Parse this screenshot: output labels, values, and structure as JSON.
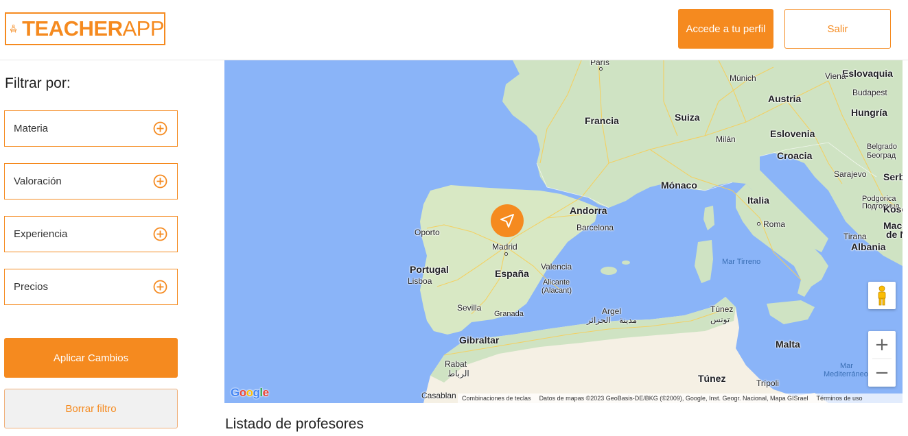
{
  "header": {
    "logo_bold": "TEACHER",
    "logo_light": "APP",
    "profile_button": "Accede a tu perfil",
    "logout_button": "Salir"
  },
  "sidebar": {
    "title": "Filtrar por:",
    "filters": [
      {
        "label": "Materia"
      },
      {
        "label": "Valoración"
      },
      {
        "label": "Experiencia"
      },
      {
        "label": "Precios"
      }
    ],
    "apply_button": "Aplicar Cambios",
    "clear_button": "Borrar filtro"
  },
  "map": {
    "countries": [
      "Francia",
      "Suiza",
      "Austria",
      "Eslovaquia",
      "Hungría",
      "Eslovenia",
      "Croacia",
      "Mónaco",
      "Italia",
      "Andorra",
      "Portugal",
      "España",
      "Gibraltar",
      "Malta",
      "Serbia",
      "Albania"
    ],
    "cities": [
      "París",
      "Múnich",
      "Viena",
      "Budapest",
      "Milán",
      "Belgrado",
      "Београд",
      "Sarajevo",
      "Podgorica",
      "Подгорица",
      "Kosov",
      "Mace",
      "de N",
      "Tirana",
      "Roma",
      "Barcelona",
      "Madrid",
      "Oporto",
      "Lisboa",
      "Valencia",
      "Alicante",
      "(Alacant)",
      "Sevilla",
      "Granada",
      "Argel",
      "الجزائر",
      "Túnez",
      "تونس",
      "Rabat",
      "الرباط",
      "Casablan",
      "Trípoli",
      "Túnez"
    ],
    "waters": [
      "Mar Tirreno",
      "Mar",
      "Mediterráneo"
    ],
    "algiers_arabic_extra": "مدينة",
    "google": "Google",
    "attribution": {
      "shortcuts": "Combinaciones de teclas",
      "data": "Datos de mapas ©2023 GeoBasis-DE/BKG (©2009), Google, Inst. Geogr. Nacional, Mapa GISrael",
      "terms": "Términos de uso"
    },
    "zoom_in": "+",
    "zoom_out": "−"
  },
  "list": {
    "title": "Listado de profesores"
  },
  "colors": {
    "accent": "#f58a1f",
    "water": "#8ab4f8",
    "land": "#cfe3c3",
    "desert": "#f5f0e4",
    "roads": "#f6cf5a"
  }
}
